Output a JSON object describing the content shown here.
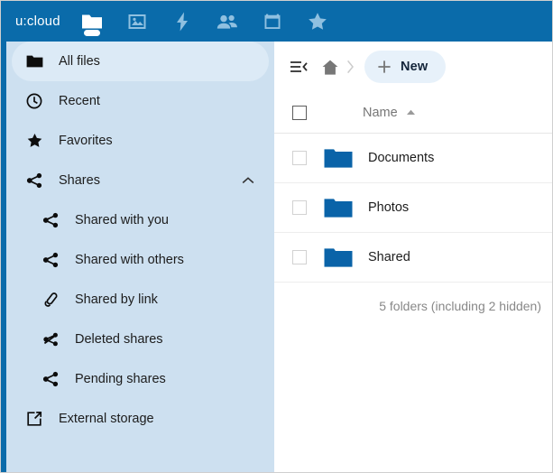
{
  "app": {
    "logo": "u:cloud",
    "accent_blue": "#0a6baa",
    "sidebar_bg": "#cde0f0",
    "folder_blue": "#0a63a8"
  },
  "topnav": {
    "items": [
      {
        "icon": "files-folder-icon",
        "name": "nav-files",
        "active": true
      },
      {
        "icon": "photos-image-icon",
        "name": "nav-photos",
        "active": false
      },
      {
        "icon": "activity-lightning-icon",
        "name": "nav-activity",
        "active": false
      },
      {
        "icon": "contacts-people-icon",
        "name": "nav-contacts",
        "active": false
      },
      {
        "icon": "calendar-icon",
        "name": "nav-calendar",
        "active": false
      },
      {
        "icon": "favorites-star-icon",
        "name": "nav-favorites",
        "active": false
      }
    ]
  },
  "sidebar": {
    "items": [
      {
        "label": "All files",
        "icon": "folder-icon",
        "sub": false,
        "active": true,
        "chevron": ""
      },
      {
        "label": "Recent",
        "icon": "clock-icon",
        "sub": false,
        "active": false,
        "chevron": ""
      },
      {
        "label": "Favorites",
        "icon": "star-icon",
        "sub": false,
        "active": false,
        "chevron": ""
      },
      {
        "label": "Shares",
        "icon": "share-icon",
        "sub": false,
        "active": false,
        "chevron": "chevron-up-icon"
      },
      {
        "label": "Shared with you",
        "icon": "share-icon",
        "sub": true,
        "active": false,
        "chevron": ""
      },
      {
        "label": "Shared with others",
        "icon": "share-icon",
        "sub": true,
        "active": false,
        "chevron": ""
      },
      {
        "label": "Shared by link",
        "icon": "link-icon",
        "sub": true,
        "active": false,
        "chevron": ""
      },
      {
        "label": "Deleted shares",
        "icon": "share-off-icon",
        "sub": true,
        "active": false,
        "chevron": ""
      },
      {
        "label": "Pending shares",
        "icon": "share-icon",
        "sub": true,
        "active": false,
        "chevron": ""
      },
      {
        "label": "External storage",
        "icon": "external-link-icon",
        "sub": false,
        "active": false,
        "chevron": ""
      }
    ]
  },
  "main": {
    "toggle_icon": "collapse-sidebar-icon",
    "breadcrumb": {
      "home_icon": "home-icon",
      "separator_icon": "chevron-right-icon"
    },
    "new_button": {
      "label": "New",
      "icon": "plus-icon"
    },
    "table": {
      "select_all_checkbox": "select-all-checkbox",
      "columns": [
        {
          "label": "Name",
          "sort": "ascending",
          "sort_icon": "sort-asc-icon"
        }
      ],
      "rows": [
        {
          "name": "Documents",
          "icon": "folder-icon",
          "checked": false
        },
        {
          "name": "Photos",
          "icon": "folder-icon",
          "checked": false
        },
        {
          "name": "Shared",
          "icon": "folder-icon",
          "checked": false
        }
      ],
      "summary": "5 folders (including 2 hidden)"
    }
  }
}
